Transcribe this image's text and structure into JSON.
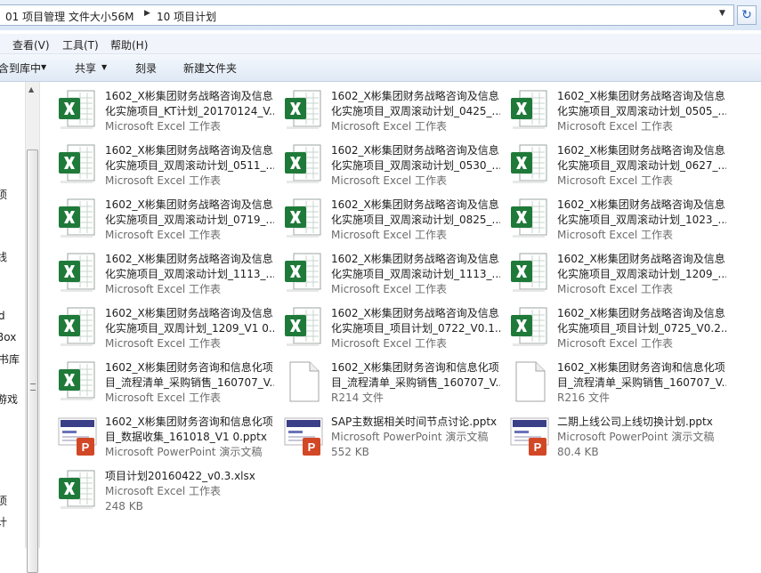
{
  "address": {
    "crumbs": [
      "01 项目管理 文件大小56M",
      "10 项目计划"
    ]
  },
  "menu": [
    "查看(V)",
    "工具(T)",
    "帮助(H)"
  ],
  "toolbar": {
    "include_library": "包含到库中",
    "share": "共享",
    "burn": "刻录",
    "new_folder": "新建文件夹"
  },
  "nav_items": [
    "项",
    "线",
    "d",
    "Box",
    "书库",
    "游戏",
    "项",
    "计"
  ],
  "files": [
    {
      "icon": "excel",
      "name": "1602_X彬集团财务战略咨询及信息\n化实施项目_KT计划_20170124_V...",
      "type": "Microsoft Excel 工作表"
    },
    {
      "icon": "excel",
      "name": "1602_X彬集团财务战略咨询及信息\n化实施项目_双周滚动计划_0425_...",
      "type": "Microsoft Excel 工作表"
    },
    {
      "icon": "excel",
      "name": "1602_X彬集团财务战略咨询及信息\n化实施项目_双周滚动计划_0505_...",
      "type": "Microsoft Excel 工作表"
    },
    {
      "icon": "excel",
      "name": "1602_X彬集团财务战略咨询及信息\n化实施项目_双周滚动计划_0511_...",
      "type": "Microsoft Excel 工作表"
    },
    {
      "icon": "excel",
      "name": "1602_X彬集团财务战略咨询及信息\n化实施项目_双周滚动计划_0530_...",
      "type": "Microsoft Excel 工作表"
    },
    {
      "icon": "excel",
      "name": "1602_X彬集团财务战略咨询及信息\n化实施项目_双周滚动计划_0627_...",
      "type": "Microsoft Excel 工作表"
    },
    {
      "icon": "excel",
      "name": "1602_X彬集团财务战略咨询及信息\n化实施项目_双周滚动计划_0719_...",
      "type": "Microsoft Excel 工作表"
    },
    {
      "icon": "excel",
      "name": "1602_X彬集团财务战略咨询及信息\n化实施项目_双周滚动计划_0825_...",
      "type": "Microsoft Excel 工作表"
    },
    {
      "icon": "excel",
      "name": "1602_X彬集团财务战略咨询及信息\n化实施项目_双周滚动计划_1023_...",
      "type": "Microsoft Excel 工作表"
    },
    {
      "icon": "excel",
      "name": "1602_X彬集团财务战略咨询及信息\n化实施项目_双周滚动计划_1113_...",
      "type": "Microsoft Excel 工作表"
    },
    {
      "icon": "excel",
      "name": "1602_X彬集团财务战略咨询及信息\n化实施项目_双周滚动计划_1113_...",
      "type": "Microsoft Excel 工作表"
    },
    {
      "icon": "excel",
      "name": "1602_X彬集团财务战略咨询及信息\n化实施项目_双周滚动计划_1209_...",
      "type": "Microsoft Excel 工作表"
    },
    {
      "icon": "excel",
      "name": "1602_X彬集团财务战略咨询及信息\n化实施项目_双周计划_1209_V1 0...",
      "type": "Microsoft Excel 工作表"
    },
    {
      "icon": "excel",
      "name": "1602_X彬集团财务战略咨询及信息\n化实施项目_项目计划_0722_V0.1...",
      "type": "Microsoft Excel 工作表"
    },
    {
      "icon": "excel",
      "name": "1602_X彬集团财务战略咨询及信息\n化实施项目_项目计划_0725_V0.2...",
      "type": "Microsoft Excel 工作表"
    },
    {
      "icon": "excel",
      "name": "1602_X彬集团财务咨询和信息化项\n目_流程清单_采购销售_160707_V...",
      "type": "Microsoft Excel 工作表"
    },
    {
      "icon": "blank",
      "name": "1602_X彬集团财务咨询和信息化项\n目_流程清单_采购销售_160707_V...",
      "type": "R214 文件"
    },
    {
      "icon": "blank",
      "name": "1602_X彬集团财务咨询和信息化项\n目_流程清单_采购销售_160707_V...",
      "type": "R216 文件"
    },
    {
      "icon": "ppt",
      "name": "1602_X彬集团财务咨询和信息化项\n目_数据收集_161018_V1 0.pptx",
      "type": "Microsoft PowerPoint 演示文稿"
    },
    {
      "icon": "ppt",
      "name": "SAP主数据相关时间节点讨论.pptx",
      "type": "Microsoft PowerPoint 演示文稿",
      "size": "552 KB"
    },
    {
      "icon": "ppt",
      "name": "二期上线公司上线切换计划.pptx",
      "type": "Microsoft PowerPoint 演示文稿",
      "size": "80.4 KB"
    },
    {
      "icon": "excel",
      "name": "项目计划20160422_v0.3.xlsx",
      "type": "Microsoft Excel 工作表",
      "size": "248 KB"
    }
  ],
  "colors": {
    "excel_green": "#1f7a3a",
    "ppt_orange": "#d24726",
    "address_bg": "#e4edf8",
    "toolbar_bg": "#dfe9f5"
  }
}
